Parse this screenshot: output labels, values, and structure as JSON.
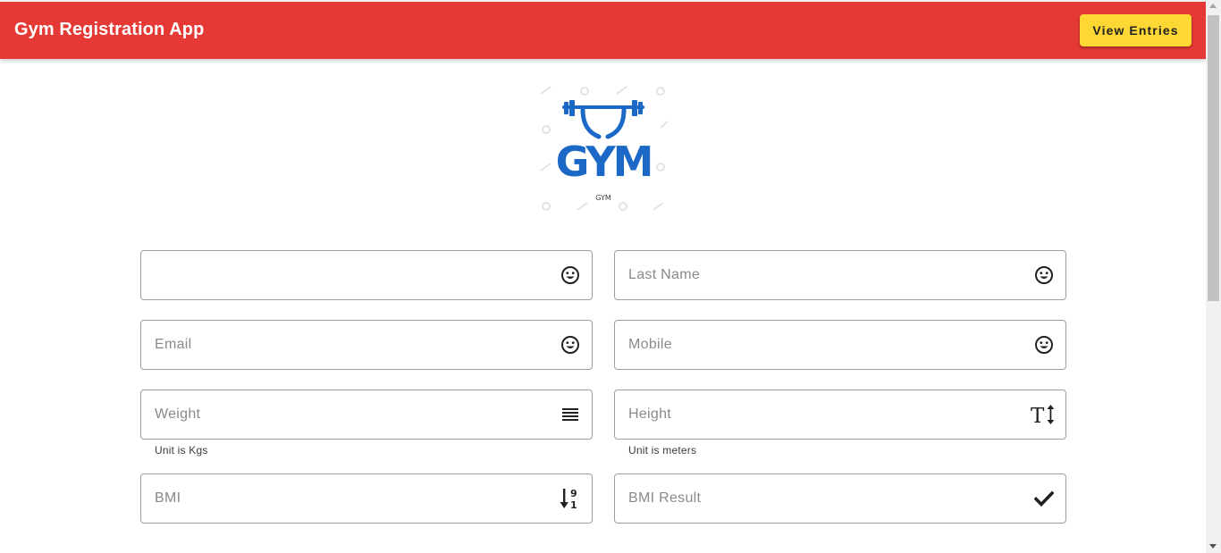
{
  "header": {
    "title": "Gym Registration App",
    "view_entries_label": "View Entries"
  },
  "logo": {
    "wordmark": "GYM",
    "caption": "GYM",
    "brand_color": "#1b68c6"
  },
  "form": {
    "first_name": {
      "placeholder": "",
      "value": "",
      "icon": "smiley-icon"
    },
    "last_name": {
      "placeholder": "Last Name",
      "value": "",
      "icon": "smiley-icon"
    },
    "email": {
      "placeholder": "Email",
      "value": "",
      "icon": "smiley-icon"
    },
    "mobile": {
      "placeholder": "Mobile",
      "value": "",
      "icon": "smiley-icon"
    },
    "weight": {
      "placeholder": "Weight",
      "value": "",
      "hint": "Unit is Kgs",
      "icon": "lines-icon"
    },
    "height": {
      "placeholder": "Height",
      "value": "",
      "hint": "Unit is meters",
      "icon": "text-height-icon"
    },
    "bmi": {
      "placeholder": "BMI",
      "value": "",
      "icon": "sort-numeric-icon"
    },
    "bmi_result": {
      "placeholder": "BMI Result",
      "value": "",
      "icon": "check-icon"
    }
  },
  "colors": {
    "toolbar": "#e53935",
    "button": "#fdd835",
    "border": "#9e9e9e"
  }
}
